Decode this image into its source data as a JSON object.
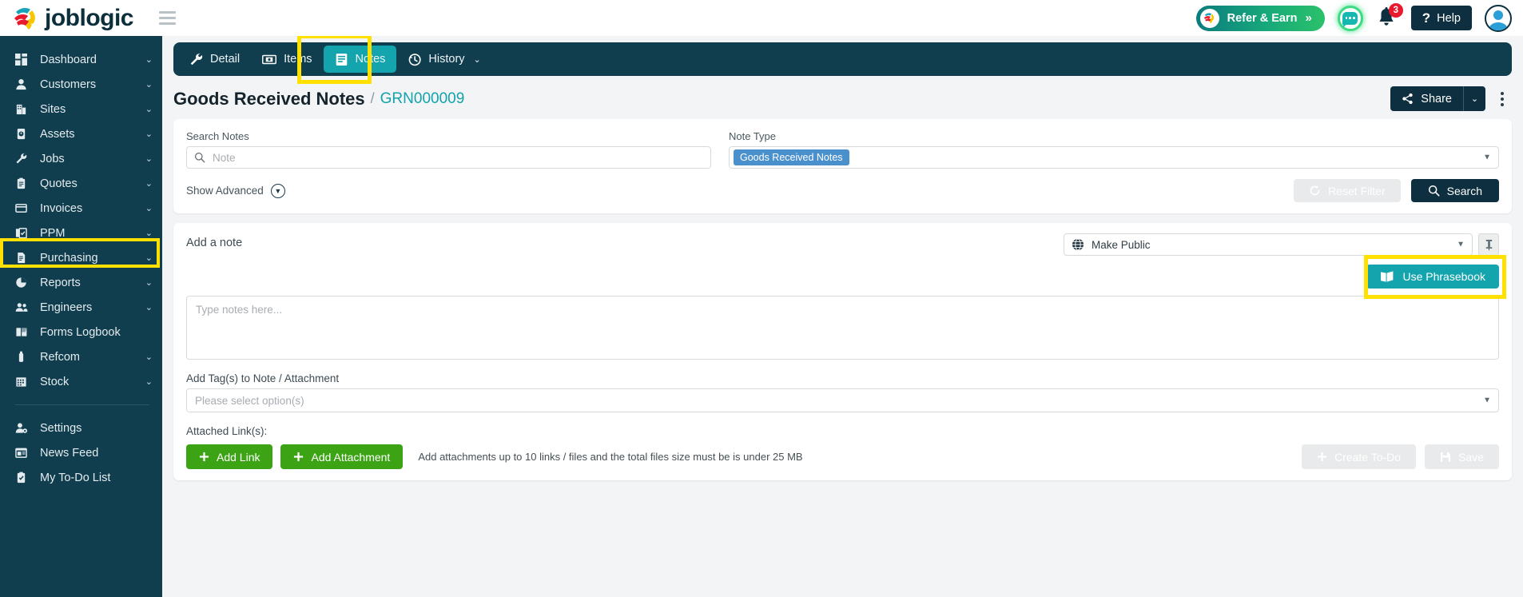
{
  "brand": {
    "name": "joblogic"
  },
  "topbar": {
    "refer_label": "Refer & Earn",
    "refer_chevron": "»",
    "notification_count": "3",
    "help_label": "Help",
    "help_icon_glyph": "?"
  },
  "sidebar": {
    "items": [
      {
        "label": "Dashboard",
        "icon": "dashboard-icon",
        "chevron": "⌄"
      },
      {
        "label": "Customers",
        "icon": "user-icon",
        "chevron": "⌄"
      },
      {
        "label": "Sites",
        "icon": "building-icon",
        "chevron": "⌄"
      },
      {
        "label": "Assets",
        "icon": "asset-icon",
        "chevron": "⌄"
      },
      {
        "label": "Jobs",
        "icon": "wrench-icon",
        "chevron": "⌄"
      },
      {
        "label": "Quotes",
        "icon": "clipboard-icon",
        "chevron": "⌄"
      },
      {
        "label": "Invoices",
        "icon": "invoice-icon",
        "chevron": "⌄"
      },
      {
        "label": "PPM",
        "icon": "calendar-check-icon",
        "chevron": "⌄"
      },
      {
        "label": "Purchasing",
        "icon": "document-icon",
        "chevron": "⌄"
      },
      {
        "label": "Reports",
        "icon": "pie-chart-icon",
        "chevron": "⌄"
      },
      {
        "label": "Engineers",
        "icon": "users-icon",
        "chevron": "⌄"
      },
      {
        "label": "Forms Logbook",
        "icon": "book-icon",
        "chevron": ""
      },
      {
        "label": "Refcom",
        "icon": "cylinder-icon",
        "chevron": "⌄"
      },
      {
        "label": "Stock",
        "icon": "grid-icon",
        "chevron": "⌄"
      }
    ],
    "bottom_items": [
      {
        "label": "Settings",
        "icon": "user-gear-icon"
      },
      {
        "label": "News Feed",
        "icon": "news-icon"
      },
      {
        "label": "My To-Do List",
        "icon": "todo-icon"
      }
    ],
    "highlighted_item": "Purchasing"
  },
  "tabs": [
    {
      "label": "Detail",
      "icon": "wrench-icon",
      "active": false,
      "chevron": ""
    },
    {
      "label": "Items",
      "icon": "items-icon",
      "active": false,
      "chevron": ""
    },
    {
      "label": "Notes",
      "icon": "notes-icon",
      "active": true,
      "chevron": ""
    },
    {
      "label": "History",
      "icon": "history-icon",
      "active": false,
      "chevron": "⌄"
    }
  ],
  "page": {
    "title": "Goods Received Notes",
    "separator": "/",
    "reference": "GRN000009",
    "share_label": "Share",
    "share_caret": "⌄"
  },
  "filter": {
    "search_label": "Search Notes",
    "search_placeholder": "Note",
    "search_value": "",
    "note_type_label": "Note Type",
    "note_type_chips": [
      "Goods Received Notes"
    ],
    "show_advanced_label": "Show Advanced",
    "reset_filter_label": "Reset Filter",
    "search_button_label": "Search"
  },
  "add_note": {
    "title": "Add a note",
    "visibility_value": "Make Public",
    "phrasebook_label": "Use Phrasebook",
    "note_placeholder": "Type notes here...",
    "note_value": "",
    "tags_label": "Add Tag(s) to Note / Attachment",
    "tags_placeholder": "Please select option(s)",
    "attached_links_label": "Attached Link(s):",
    "add_link_label": "Add Link",
    "add_attachment_label": "Add Attachment",
    "attachment_hint": "Add attachments up to 10 links / files and the total files size must be is under 25 MB",
    "create_todo_label": "Create To-Do",
    "save_label": "Save"
  },
  "colors": {
    "sidebar_bg": "#103e4f",
    "accent_teal": "#13a4ad",
    "highlight_yellow": "#ffe000",
    "green_button": "#3ba314",
    "chip_blue": "#4a90cd",
    "dark_button": "#0e2f3f"
  }
}
